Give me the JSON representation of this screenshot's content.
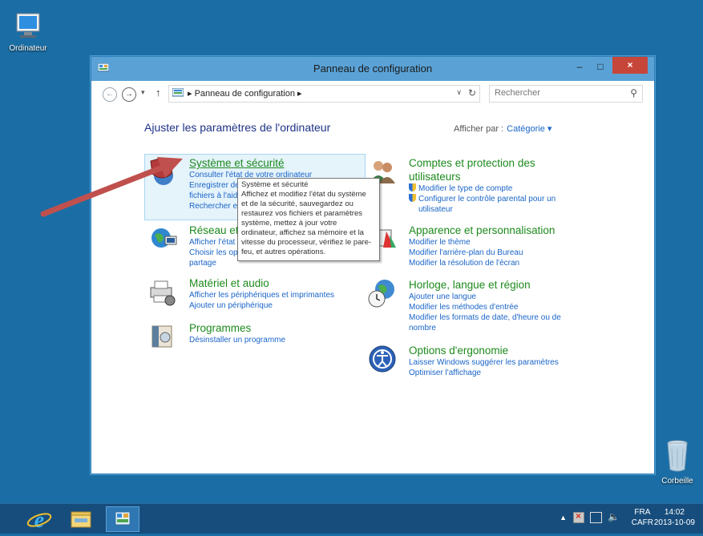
{
  "desktop": {
    "computer_label": "Ordinateur",
    "recycle_label": "Corbeille"
  },
  "window": {
    "title": "Panneau de configuration",
    "close_label": "×",
    "minimize_label": "–",
    "maximize_label": "□"
  },
  "navbar": {
    "address": "Panneau de configuration",
    "search_placeholder": "Rechercher"
  },
  "content": {
    "heading": "Ajuster les paramètres de l'ordinateur",
    "view_by_label": "Afficher par :",
    "view_by_value": "Catégorie ▾"
  },
  "categories": {
    "system": {
      "title": "Système et sécurité",
      "links": [
        "Consulter l'état de votre ordinateur",
        "Enregistrer des copies de sauvegarde de vos",
        "fichiers à l'aide de l'Historique des fichiers",
        "Rechercher et résoudre des problèmes"
      ]
    },
    "network": {
      "title": "Réseau et Internet",
      "links": [
        "Afficher l'état et la gestion du réseau",
        "Choisir les options de groupe résidentiel et de",
        "partage"
      ]
    },
    "hardware": {
      "title": "Matériel et audio",
      "links": [
        "Afficher les périphériques et imprimantes",
        "Ajouter un périphérique"
      ]
    },
    "programs": {
      "title": "Programmes",
      "links": [
        "Désinstaller un programme"
      ]
    },
    "accounts": {
      "title_line1": "Comptes et protection des",
      "title_line2": "utilisateurs",
      "links": [
        "Modifier le type de compte",
        "Configurer le contrôle parental pour un",
        "utilisateur"
      ]
    },
    "appearance": {
      "title": "Apparence et personnalisation",
      "links": [
        "Modifier le thème",
        "Modifier l'arrière-plan du Bureau",
        "Modifier la résolution de l'écran"
      ]
    },
    "clock": {
      "title": "Horloge, langue et région",
      "links": [
        "Ajouter une langue",
        "Modifier les méthodes d'entrée",
        "Modifier les formats de date, d'heure ou de",
        "nombre"
      ]
    },
    "ease": {
      "title": "Options d'ergonomie",
      "links": [
        "Laisser Windows suggérer les paramètres",
        "Optimiser l'affichage"
      ]
    }
  },
  "tooltip": {
    "title": "Système et sécurité",
    "lines": [
      "Affichez et modifiez l'état du système",
      "et de la sécurité, sauvegardez ou",
      "restaurez vos fichiers et paramètres",
      "système, mettez à jour votre",
      "ordinateur, affichez sa mémoire et la",
      "vitesse du processeur, vérifiez le pare-",
      "feu, et autres opérations."
    ]
  },
  "taskbar": {
    "lang_line1": "FRA",
    "lang_line2": "CAFR",
    "time": "14:02",
    "date": "2013-10-09"
  },
  "colors": {
    "desktop": "#1b6ea5",
    "titlebar": "#5aa2d6",
    "close": "#c7463a",
    "category_title": "#1d8a1d",
    "link": "#1a65c8",
    "arrow": "#c0504d"
  }
}
